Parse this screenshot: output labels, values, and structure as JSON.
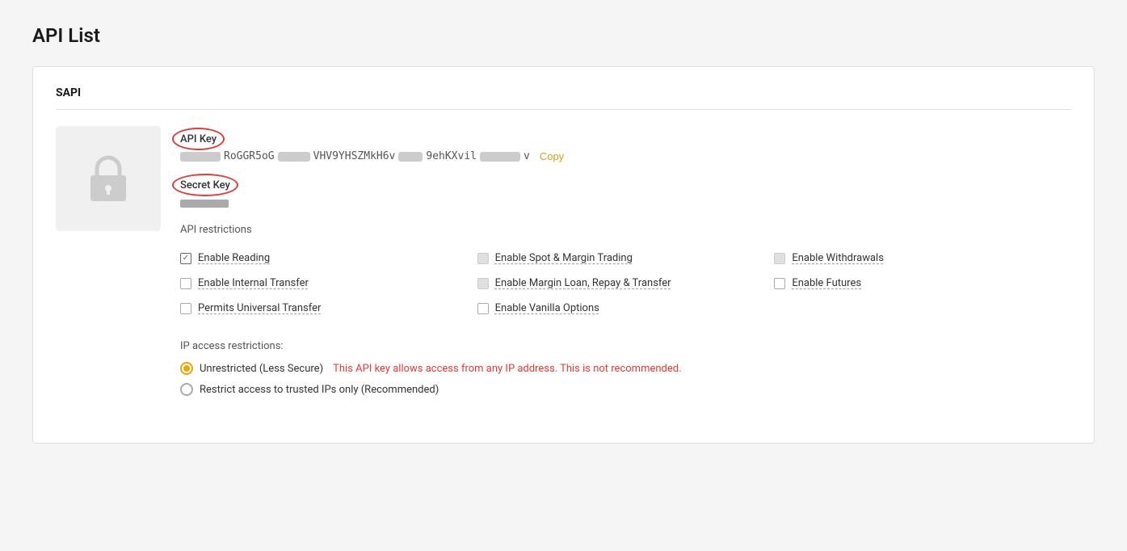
{
  "page": {
    "title": "API List"
  },
  "card": {
    "section_title": "SAPI"
  },
  "api_key": {
    "label": "API Key",
    "value_visible": "RoGGR5oG",
    "value_mid1": "VHV9YHSZMkH6v",
    "value_mid2": "9ehKXvil",
    "value_end": "v",
    "copy_label": "Copy"
  },
  "secret_key": {
    "label": "Secret Key"
  },
  "restrictions": {
    "title": "API restrictions",
    "items": [
      {
        "id": "read",
        "label": "Enable Reading",
        "checked": true,
        "col": 0
      },
      {
        "id": "internal",
        "label": "Enable Internal Transfer",
        "checked": false,
        "col": 0
      },
      {
        "id": "universal",
        "label": "Permits Universal Transfer",
        "checked": false,
        "col": 0
      },
      {
        "id": "spot",
        "label": "Enable Spot & Margin Trading",
        "checked": false,
        "col": 1
      },
      {
        "id": "margin",
        "label": "Enable Margin Loan, Repay & Transfer",
        "checked": false,
        "col": 1
      },
      {
        "id": "vanilla",
        "label": "Enable Vanilla Options",
        "checked": false,
        "col": 1
      },
      {
        "id": "withdrawals",
        "label": "Enable Withdrawals",
        "checked": false,
        "col": 2
      },
      {
        "id": "futures",
        "label": "Enable Futures",
        "checked": false,
        "col": 2
      }
    ]
  },
  "ip_restrictions": {
    "title": "IP access restrictions:",
    "options": [
      {
        "id": "unrestricted",
        "label": "Unrestricted (Less Secure)",
        "warning": "This API key allows access from any IP address. This is not recommended.",
        "selected": true
      },
      {
        "id": "restricted",
        "label": "Restrict access to trusted IPs only (Recommended)",
        "warning": "",
        "selected": false
      }
    ]
  }
}
